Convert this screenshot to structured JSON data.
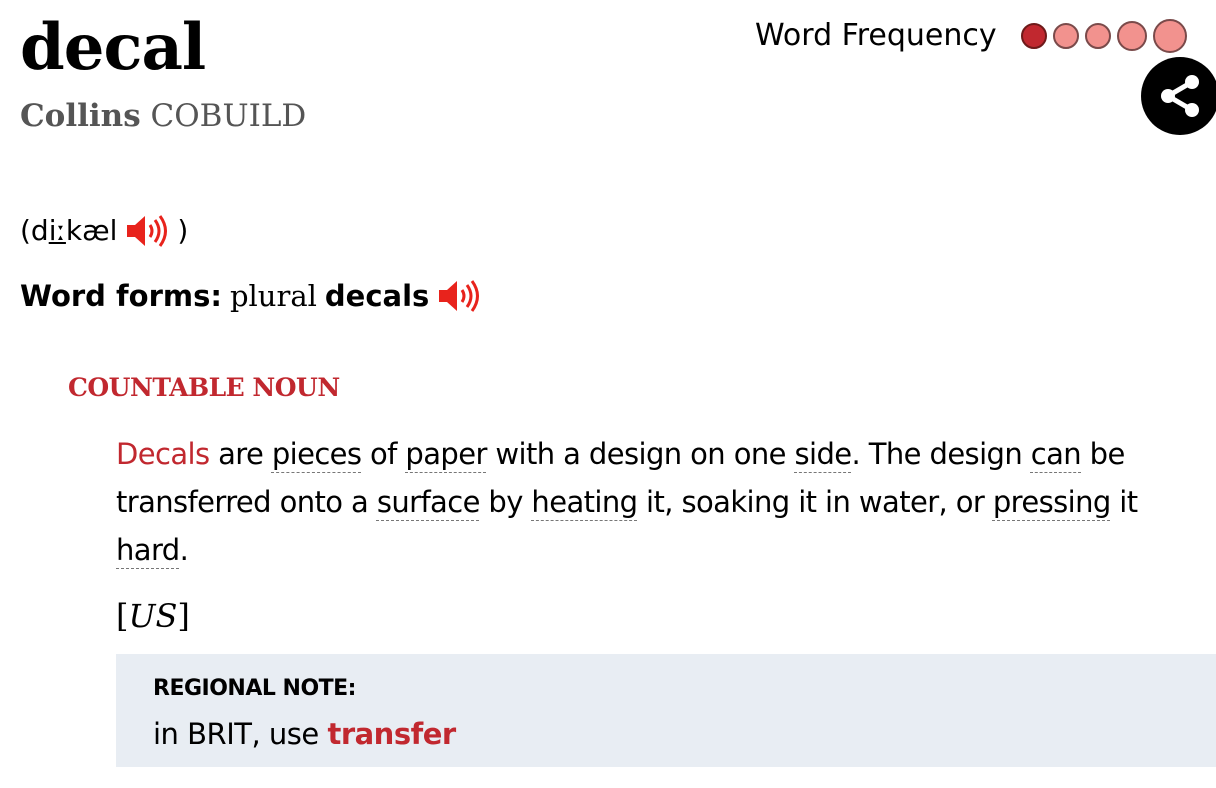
{
  "entry": {
    "headword": "decal",
    "source_brand": "Collins",
    "source_name": "COBUILD"
  },
  "frequency": {
    "label": "Word Frequency",
    "level": 1,
    "max": 5,
    "active_color": "#c1282f",
    "inactive_color": "#f2928e"
  },
  "share": {
    "icon": "share-icon"
  },
  "pronunciation": {
    "open": "(d",
    "stressed": "iː",
    "rest": "kæl",
    "close": ")",
    "audio_icon": "speaker-icon"
  },
  "word_forms": {
    "label": "Word forms:",
    "type": "plural",
    "form": "decals",
    "audio_icon": "speaker-icon"
  },
  "sense": {
    "part_of_speech": "COUNTABLE NOUN",
    "definition": [
      {
        "text": "Decals",
        "style": "hw"
      },
      {
        "text": " are ",
        "style": ""
      },
      {
        "text": "pieces",
        "style": "lk"
      },
      {
        "text": " of ",
        "style": ""
      },
      {
        "text": "paper",
        "style": "lk"
      },
      {
        "text": " with a design on one ",
        "style": ""
      },
      {
        "text": "side",
        "style": "lk"
      },
      {
        "text": ". The design ",
        "style": ""
      },
      {
        "text": "can",
        "style": "lk"
      },
      {
        "text": " be transferred onto a ",
        "style": ""
      },
      {
        "text": "surface",
        "style": "lk"
      },
      {
        "text": " by ",
        "style": ""
      },
      {
        "text": "heating",
        "style": "lk"
      },
      {
        "text": " it, soaking it in water, or ",
        "style": ""
      },
      {
        "text": "pressing",
        "style": "lk"
      },
      {
        "text": " it ",
        "style": ""
      },
      {
        "text": "hard",
        "style": "lk"
      },
      {
        "text": ".",
        "style": ""
      }
    ],
    "usage_open": "[",
    "usage": "US",
    "usage_close": "]",
    "note": {
      "title": "REGIONAL NOTE:",
      "body": "in BRIT, use ",
      "xref": "transfer"
    }
  },
  "colors": {
    "brand_red": "#c1282f",
    "speaker_red": "#e8231c",
    "note_bg": "#e8edf3"
  }
}
